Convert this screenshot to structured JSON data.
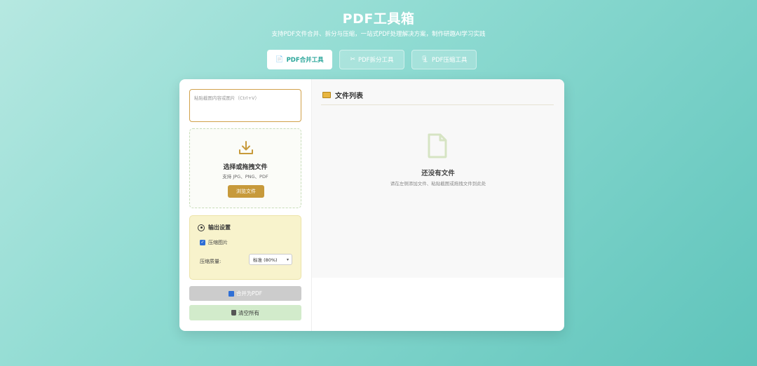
{
  "header": {
    "title": "PDF工具箱",
    "subtitle": "支持PDF文件合并、拆分与压缩，一站式PDF处理解决方案，制作研趣AI学习实践"
  },
  "tabs": [
    {
      "label": "PDF合并工具",
      "icon": "document-icon",
      "active": true
    },
    {
      "label": "PDF拆分工具",
      "icon": "scissors-icon",
      "active": false
    },
    {
      "label": "PDF压缩工具",
      "icon": "compress-icon",
      "active": false
    }
  ],
  "left": {
    "paste_placeholder": "粘贴截图内容或图片（Ctrl+V）",
    "drop": {
      "title": "选择或拖拽文件",
      "hint": "支持 JPG、PNG、PDF",
      "browse_label": "浏览文件"
    },
    "settings": {
      "title": "输出设置",
      "compress_label": "压缩图片",
      "compress_checked": true,
      "quality_label": "压缩质量:",
      "quality_value": "标准 (80%)"
    },
    "merge_label": "合并为PDF",
    "clear_label": "清空所有"
  },
  "right": {
    "title": "文件列表",
    "empty_title": "还没有文件",
    "empty_hint": "请在左侧添加文件、粘贴截图或拖拽文件到此处"
  },
  "colors": {
    "accent": "#2aa69a",
    "browse": "#c79a3b",
    "settings_bg": "#f8f3cc",
    "clear_bg": "#d2ebcb"
  }
}
